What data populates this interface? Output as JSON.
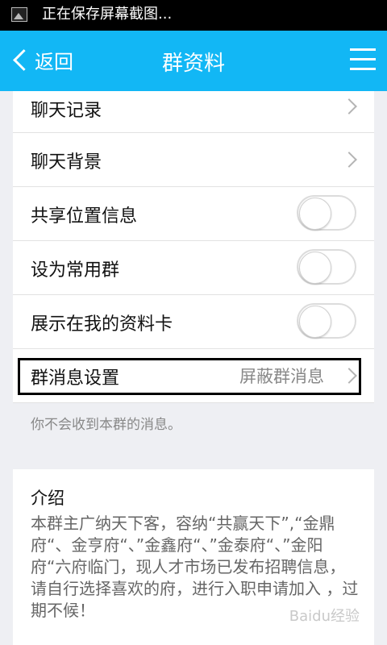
{
  "status_bar": {
    "icon": "image-icon",
    "text": "正在保存屏幕截图..."
  },
  "header": {
    "back_label": "返回",
    "title": "群资料",
    "menu_icon": "menu-icon",
    "color": "#12b7f5"
  },
  "rows": [
    {
      "label": "聊天记录"
    },
    {
      "label": "聊天背景"
    },
    {
      "label": "共享位置信息",
      "toggle_on": false
    },
    {
      "label": "设为常用群",
      "toggle_on": false
    },
    {
      "label": "展示在我的资料卡",
      "toggle_on": false
    },
    {
      "label": "群消息设置",
      "value": "屏蔽群消息"
    }
  ],
  "note": "你不会收到本群的消息。",
  "intro": {
    "title": "介绍",
    "text": "本群主广纳天下客，容纳“共赢天下”,“金鼎府“、金亨府“、”金鑫府“、”金泰府“、”金阳府“六府临门，现人才市场已发布招聘信息，请自行选择喜欢的府，进行入职申请加入 ，过期不候！"
  },
  "watermark": "Baidu经验"
}
